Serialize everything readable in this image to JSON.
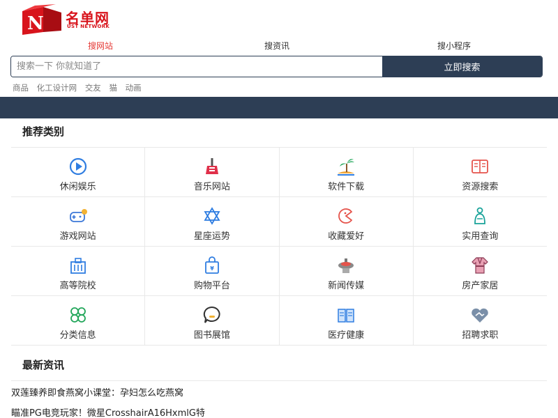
{
  "logo": {
    "text_cn": "名单网",
    "text_en": "UST NETWORK",
    "box_letter": "N"
  },
  "tabs": [
    {
      "label": "搜网站",
      "active": true
    },
    {
      "label": "搜资讯",
      "active": false
    },
    {
      "label": "搜小程序",
      "active": false
    }
  ],
  "search": {
    "placeholder": "搜索一下 你就知道了",
    "button": "立即搜索"
  },
  "hot_words": [
    "商品",
    "化工设计网",
    "交友",
    "猫",
    "动画"
  ],
  "recommend": {
    "title": "推荐类别",
    "items": [
      {
        "label": "休闲娱乐",
        "icon": "play-icon"
      },
      {
        "label": "音乐网站",
        "icon": "guitar-icon"
      },
      {
        "label": "软件下载",
        "icon": "island-icon"
      },
      {
        "label": "资源搜索",
        "icon": "book-icon"
      },
      {
        "label": "游戏网站",
        "icon": "gamepad-icon"
      },
      {
        "label": "星座运势",
        "icon": "star-icon"
      },
      {
        "label": "收藏爱好",
        "icon": "pacman-icon"
      },
      {
        "label": "实用查询",
        "icon": "person-icon"
      },
      {
        "label": "高等院校",
        "icon": "school-icon"
      },
      {
        "label": "购物平台",
        "icon": "shopping-bag-icon"
      },
      {
        "label": "新闻传媒",
        "icon": "satellite-icon"
      },
      {
        "label": "房产家居",
        "icon": "robe-icon"
      },
      {
        "label": "分类信息",
        "icon": "clover-icon"
      },
      {
        "label": "图书展馆",
        "icon": "chat-icon"
      },
      {
        "label": "医疗健康",
        "icon": "open-book-icon"
      },
      {
        "label": "招聘求职",
        "icon": "handshake-icon"
      }
    ]
  },
  "news": {
    "title": "最新资讯",
    "items": [
      "双莲臻养即食燕窝小课堂：孕妇怎么吃燕窝",
      "瞄准PG电竞玩家！微星CrosshairA16HxmlG特"
    ]
  },
  "colors": {
    "accent": "#e53935",
    "dark": "#2d3e55"
  }
}
